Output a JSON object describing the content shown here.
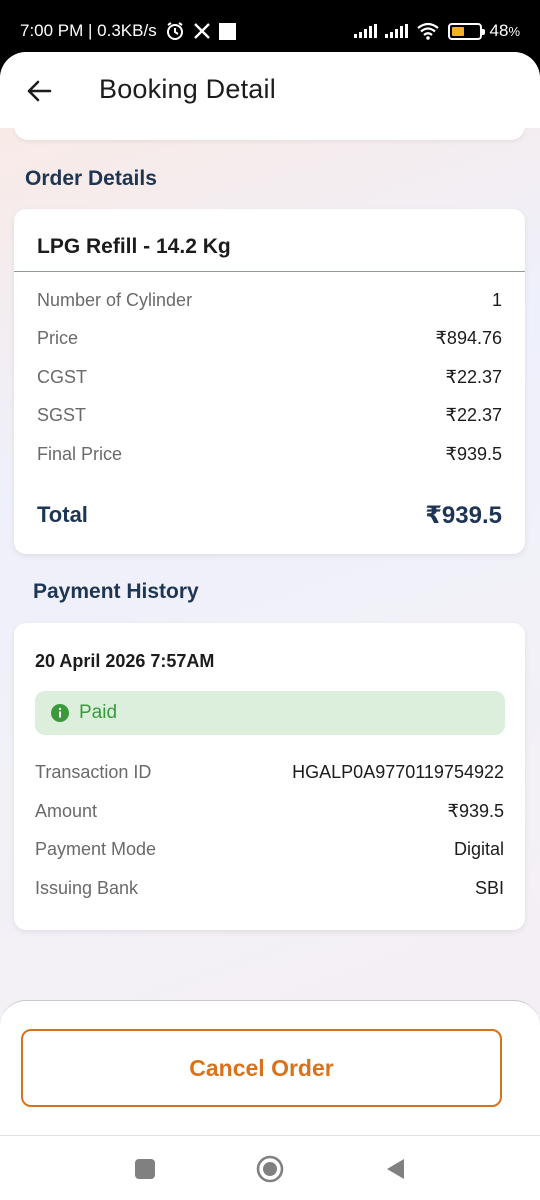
{
  "status_bar": {
    "time_speed": "7:00 PM | 0.3KB/s",
    "battery": "48",
    "battery_unit": "%",
    "battery_level": 0.48,
    "icons": [
      "alarm-icon",
      "x-logo-icon",
      "notification-square-icon",
      "signal-icon",
      "signal-icon",
      "wifi-icon",
      "battery-icon"
    ]
  },
  "header": {
    "title": "Booking Detail",
    "back_icon": "arrow-left-icon"
  },
  "order_details": {
    "section_title": "Order Details",
    "product": "LPG Refill - 14.2 Kg",
    "rows": [
      {
        "label": "Number of Cylinder",
        "value": "1"
      },
      {
        "label": "Price",
        "value": "₹894.76"
      },
      {
        "label": "CGST",
        "value": "₹22.37"
      },
      {
        "label": "SGST",
        "value": "₹22.37"
      },
      {
        "label": "Final Price",
        "value": "₹939.5"
      }
    ],
    "total_label": "Total",
    "total_value": "₹939.5"
  },
  "payment_history": {
    "section_title": "Payment History",
    "date": "20 April 2026 7:57AM",
    "status": "Paid",
    "status_icon": "info-icon",
    "rows": [
      {
        "label": "Transaction ID",
        "value": "HGALP0A9770119754922"
      },
      {
        "label": "Amount",
        "value": "₹939.5"
      },
      {
        "label": "Payment Mode",
        "value": "Digital"
      },
      {
        "label": "Issuing Bank",
        "value": "SBI"
      }
    ]
  },
  "actions": {
    "cancel_label": "Cancel Order"
  },
  "colors": {
    "accent": "#d9731b",
    "heading": "#1e3553",
    "paid_bg": "#dcefdc",
    "paid_text": "#3a9a3a"
  },
  "nav_bar": {
    "icons": [
      "recents-square-icon",
      "home-circle-icon",
      "back-triangle-icon"
    ]
  }
}
